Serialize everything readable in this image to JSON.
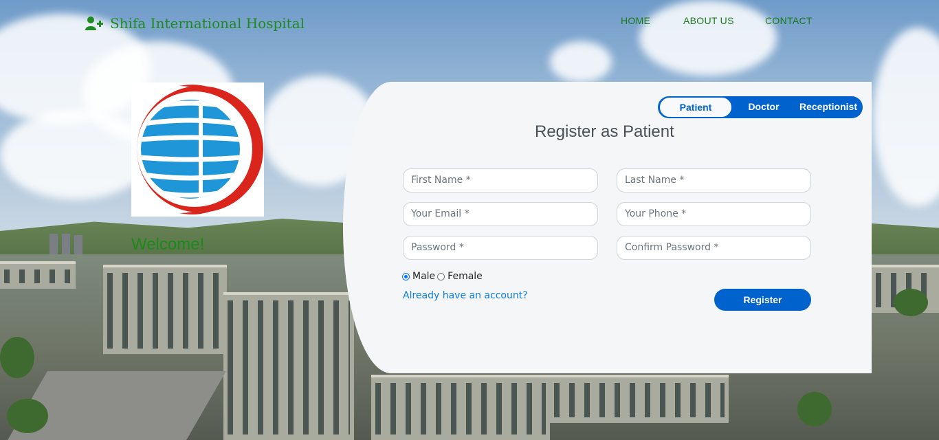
{
  "header": {
    "brand_name": "Shifa International Hospital",
    "brand_icon": "user-plus-icon",
    "nav": {
      "home": "HOME",
      "about": "ABOUT US",
      "contact": "CONTACT"
    }
  },
  "hero": {
    "welcome": "Welcome!"
  },
  "register_card": {
    "roles": {
      "patient": "Patient",
      "doctor": "Doctor",
      "receptionist": "Receptionist",
      "selected": "Patient"
    },
    "title": "Register as Patient",
    "fields": {
      "first_name": "First Name *",
      "last_name": "Last Name *",
      "email": "Your Email *",
      "phone": "Your Phone *",
      "password": "Password *",
      "confirm_password": "Confirm Password *"
    },
    "gender": {
      "male": "Male",
      "female": "Female",
      "selected": "Male"
    },
    "login_link": "Already have an account?",
    "register_button": "Register"
  },
  "colors": {
    "brand_green": "#1f8a1f",
    "primary_blue": "#0062cc",
    "logo_red": "#d9251c",
    "logo_blue": "#1e96d8"
  }
}
